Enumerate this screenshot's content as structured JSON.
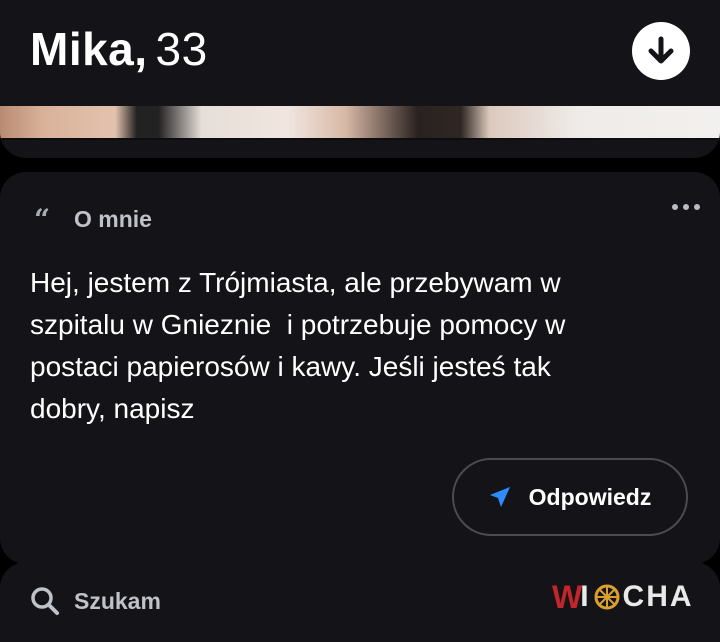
{
  "profile": {
    "name": "Mika",
    "separator": ",",
    "age": "33",
    "collapse_icon": "arrow-down-icon"
  },
  "about": {
    "quote_icon": "quote-icon",
    "quote_glyph": "“",
    "title": "O mnie",
    "more_icon": "more-horizontal-icon",
    "text": "Hej, jestem z Trójmiasta, ale przebywam w\nszpitalu w Gnieznie  i potrzebuje pomocy w\npostaci papierosów i kawy. Jeśli jesteś tak\ndobry, napisz",
    "reply_label": "Odpowiedz",
    "reply_icon": "send-icon"
  },
  "search": {
    "icon": "search-icon",
    "label": "Szukam"
  },
  "watermark": {
    "logo_text": "WIOCHA"
  },
  "colors": {
    "background": "#000000",
    "card": "#141418",
    "accent_blue": "#2f8cff",
    "muted_text": "#bfc2c9",
    "watermark_red": "#c0262a"
  }
}
